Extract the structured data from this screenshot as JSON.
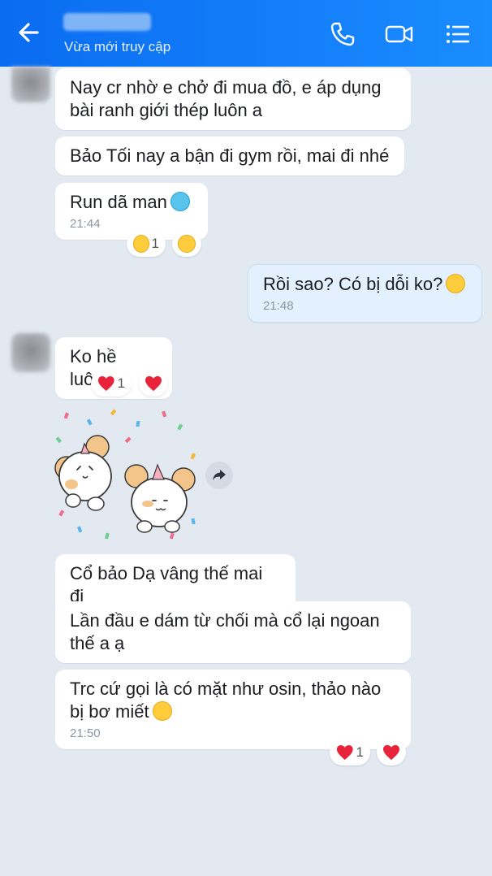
{
  "header": {
    "status": "Vừa mới truy cập",
    "bg_color": "#1a8cff"
  },
  "messages": [
    {
      "text": "Nay cr nhờ e chở đi mua đồ, e áp dụng bài ranh giới thép luôn a"
    },
    {
      "text": "Bảo Tối nay a bận đi gym rồi, mai đi nhé"
    },
    {
      "text": "Run dã man",
      "emoji": "cold-face-icon",
      "time": "21:44",
      "reaction_count": "1",
      "reaction": "laugh-icon"
    },
    {
      "text": "Rồi sao? Có bị dỗi ko?",
      "emoji": "smirk-icon",
      "time": "21:48",
      "outgoing": true
    },
    {
      "text": "Ko hề luôn!",
      "reaction_count": "1",
      "reaction": "heart-icon"
    },
    {
      "text": "Cổ bảo Dạ vâng thế mai đi"
    },
    {
      "text": "Lần đầu e dám từ chối mà cổ lại ngoan thế a ạ"
    },
    {
      "text": "Trc cứ gọi là có mặt như osin, thảo nào bị bơ miết",
      "emoji": "sweat-smile-icon",
      "time": "21:50",
      "reaction_count": "1",
      "reaction": "heart-icon"
    }
  ]
}
